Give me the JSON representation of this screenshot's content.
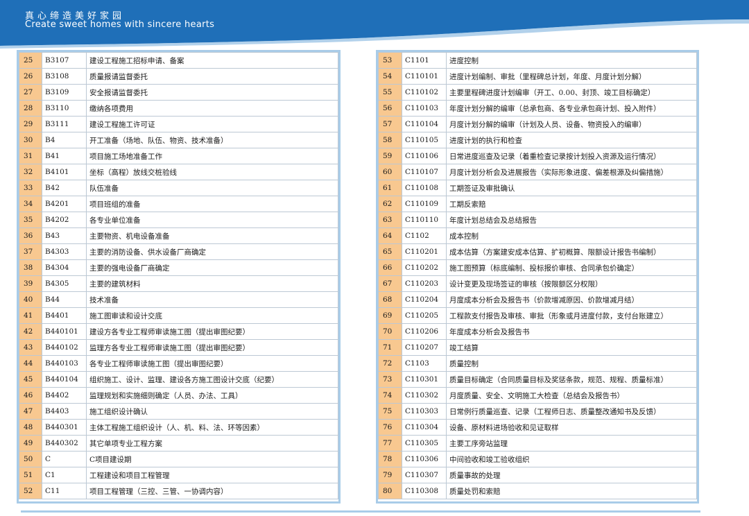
{
  "banner": {
    "title_cn": "真心缔造美好家园",
    "title_en": "Create sweet homes with sincere hearts",
    "color": "#1f6fb8"
  },
  "left_table": [
    {
      "no": "25",
      "code": "B3107",
      "item": "建设工程施工招标申请、备案"
    },
    {
      "no": "26",
      "code": "B3108",
      "item": "质量报请监督委托"
    },
    {
      "no": "27",
      "code": "B3109",
      "item": "安全报请监督委托"
    },
    {
      "no": "28",
      "code": "B3110",
      "item": "缴纳各项费用"
    },
    {
      "no": "29",
      "code": "B3111",
      "item": "建设工程施工许可证"
    },
    {
      "no": "30",
      "code": "B4",
      "item": "开工准备（场地、队伍、物资、技术准备）"
    },
    {
      "no": "31",
      "code": "B41",
      "item": "项目施工场地准备工作"
    },
    {
      "no": "32",
      "code": "B4101",
      "item": "坐标（高程）放线交桩验线"
    },
    {
      "no": "33",
      "code": "B42",
      "item": "队伍准备"
    },
    {
      "no": "34",
      "code": "B4201",
      "item": "项目班组的准备"
    },
    {
      "no": "35",
      "code": "B4202",
      "item": "各专业单位准备"
    },
    {
      "no": "36",
      "code": "B43",
      "item": "主要物资、机电设备准备"
    },
    {
      "no": "37",
      "code": "B4303",
      "item": "主要的消防设备、供水设备厂商确定"
    },
    {
      "no": "38",
      "code": "B4304",
      "item": "主要的强电设备厂商确定"
    },
    {
      "no": "39",
      "code": "B4305",
      "item": "主要的建筑材料"
    },
    {
      "no": "40",
      "code": "B44",
      "item": "技术准备"
    },
    {
      "no": "41",
      "code": "B4401",
      "item": "施工图审读和设计交底"
    },
    {
      "no": "42",
      "code": "B440101",
      "item": "建设方各专业工程师审读施工图（提出审图纪要）"
    },
    {
      "no": "43",
      "code": "B440102",
      "item": "监理方各专业工程师审读施工图（提出审图纪要）"
    },
    {
      "no": "44",
      "code": "B440103",
      "item": "各专业工程师审读施工图（提出审图纪要）"
    },
    {
      "no": "45",
      "code": "B440104",
      "item": "组织施工、设计、监理、建设各方施工图设计交底（纪要）"
    },
    {
      "no": "46",
      "code": "B4402",
      "item": "监理规划和实施细则确定（人员、办法、工具）"
    },
    {
      "no": "47",
      "code": "B4403",
      "item": "施工组织设计确认"
    },
    {
      "no": "48",
      "code": "B440301",
      "item": "主体工程施工组织设计（人、机、料、法、环等因素）"
    },
    {
      "no": "49",
      "code": "B440302",
      "item": "其它单项专业工程方案"
    },
    {
      "no": "50",
      "code": "C",
      "item": "C项目建设期"
    },
    {
      "no": "51",
      "code": "C1",
      "item": "工程建设和项目工程管理"
    },
    {
      "no": "52",
      "code": "C11",
      "item": "项目工程管理（三控、三管、一协调内容）"
    }
  ],
  "right_table": [
    {
      "no": "53",
      "code": "C1101",
      "item": "进度控制"
    },
    {
      "no": "54",
      "code": "C110101",
      "item": "进度计划编制、审批（里程碑总计划，年度、月度计划分解）"
    },
    {
      "no": "55",
      "code": "C110102",
      "item": "主要里程碑进度计划编审（开工、0.00、封顶、竣工目标确定）"
    },
    {
      "no": "56",
      "code": "C110103",
      "item": "年度计划分解的编审（总承包商、各专业承包商计划、投入附件）"
    },
    {
      "no": "57",
      "code": "C110104",
      "item": "月度计划分解的编审（计划及人员、设备、物资投入的编审）"
    },
    {
      "no": "58",
      "code": "C110105",
      "item": "进度计划的执行和检查"
    },
    {
      "no": "59",
      "code": "C110106",
      "item": "日常进度巡查及记录（着重检查记录按计划投入资源及运行情况）"
    },
    {
      "no": "60",
      "code": "C110107",
      "item": "月度计划分析会及进展报告（实际形象进度、偏差根源及纠偏措施）"
    },
    {
      "no": "61",
      "code": "C110108",
      "item": "工期签证及审批确认"
    },
    {
      "no": "62",
      "code": "C110109",
      "item": "工期反索赔"
    },
    {
      "no": "63",
      "code": "C110110",
      "item": "年度计划总结会及总结报告"
    },
    {
      "no": "64",
      "code": "C1102",
      "item": "成本控制"
    },
    {
      "no": "65",
      "code": "C110201",
      "item": "成本估算（方案建安成本估算、扩初概算、限额设计报告书编制）"
    },
    {
      "no": "66",
      "code": "C110202",
      "item": "施工图预算（标底编制、投标报价审核、合同承包价确定）"
    },
    {
      "no": "67",
      "code": "C110203",
      "item": "设计变更及现场签证的审核（按限额区分权限）"
    },
    {
      "no": "68",
      "code": "C110204",
      "item": "月度成本分析会及报告书（价款增减原因、价款增减月结）"
    },
    {
      "no": "69",
      "code": "C110205",
      "item": "工程款支付报告及审核、审批（形象或月进度付款，支付台账建立）"
    },
    {
      "no": "70",
      "code": "C110206",
      "item": "年度成本分析会及报告书"
    },
    {
      "no": "71",
      "code": "C110207",
      "item": "竣工结算"
    },
    {
      "no": "72",
      "code": "C1103",
      "item": "质量控制"
    },
    {
      "no": "73",
      "code": "C110301",
      "item": "质量目标确定（合同质量目标及奖惩条款，规范、规程、质量标准）"
    },
    {
      "no": "74",
      "code": "C110302",
      "item": "月度质量、安全、文明施工大检查（总结会及报告书）"
    },
    {
      "no": "75",
      "code": "C110303",
      "item": "日常例行质量巡查、记录（工程师日志、质量整改通知书及反馈）"
    },
    {
      "no": "76",
      "code": "C110304",
      "item": "设备、原材料进场验收和见证取样"
    },
    {
      "no": "77",
      "code": "C110305",
      "item": "主要工序旁站监理"
    },
    {
      "no": "78",
      "code": "C110306",
      "item": "中间验收和竣工验收组织"
    },
    {
      "no": "79",
      "code": "C110307",
      "item": "质量事故的处理"
    },
    {
      "no": "80",
      "code": "C110308",
      "item": "质量处罚和索赔"
    }
  ]
}
